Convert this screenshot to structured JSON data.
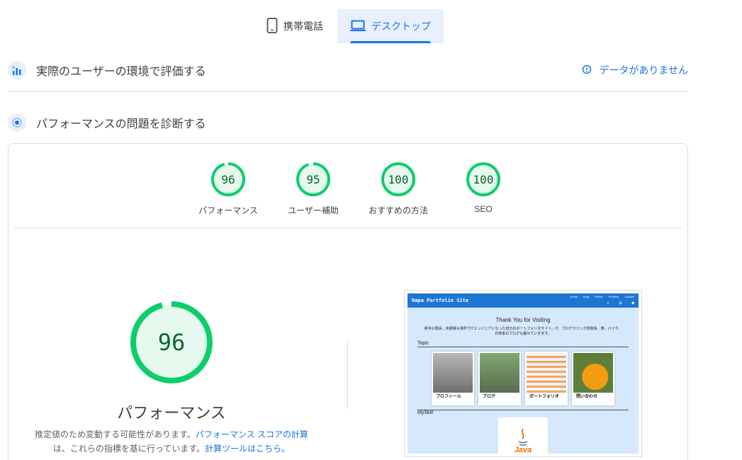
{
  "tabs": [
    {
      "label": "携帯電話",
      "icon": "phone-icon",
      "active": false
    },
    {
      "label": "デスクトップ",
      "icon": "laptop-icon",
      "active": true
    }
  ],
  "field_data": {
    "title": "実際のユーザーの環境で評価する",
    "no_data": "データがありません"
  },
  "lab": {
    "title": "パフォーマンスの問題を診断する",
    "gauges": [
      {
        "score": "96",
        "label": "パフォーマンス"
      },
      {
        "score": "95",
        "label": "ユーザー補助"
      },
      {
        "score": "100",
        "label": "おすすめの方法"
      },
      {
        "score": "100",
        "label": "SEO"
      }
    ],
    "main_score": "96",
    "main_label": "パフォーマンス",
    "note_prefix": "推定値のため変動する可能性があります。",
    "note_link1": "パフォーマンス スコアの計算",
    "note_mid": "は、これらの指標を基に行っています。",
    "note_link2": "計算ツールはこちら。"
  },
  "thumbnail": {
    "site_title": "Napa Portfolio Site",
    "nav": [
      "Home",
      "Blog",
      "Profile",
      "Portfolio",
      "Contact"
    ],
    "thanks": "Thank You for Visiting",
    "desc": "新卒公務員→未経験＆独学でITエンジニアになった自分のポートフォリオサイト。IT、プログラミング技術系、車、バイク、日常系のブログも載せていきます。",
    "topic": "Topic",
    "cards": [
      "プロフィール",
      "ブログ",
      "ポートフォリオ",
      "問い合わせ"
    ],
    "myskill": "MySkill",
    "java": "Java"
  },
  "colors": {
    "accent": "#1a73e8",
    "pass": "#0cce6b",
    "pass_text": "#0d652d"
  }
}
